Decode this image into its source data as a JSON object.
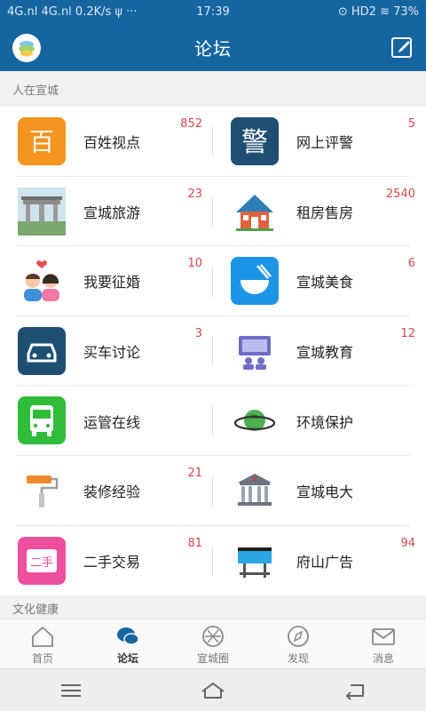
{
  "status_bar": {
    "left": "4G.nl 4G.nl 0.2K/s ψ ···",
    "time": "17:39",
    "right": "⊙ HD2 ≋ 73%"
  },
  "header": {
    "title": "论坛"
  },
  "sections": {
    "people": "人在宣城",
    "culture": "文化健康"
  },
  "grid": {
    "items": [
      {
        "label": "百姓视点",
        "badge": "852",
        "icon": "bai-icon"
      },
      {
        "label": "网上评警",
        "badge": "5",
        "icon": "jing-icon"
      },
      {
        "label": "宣城旅游",
        "badge": "23",
        "icon": "gate-icon"
      },
      {
        "label": "租房售房",
        "badge": "2540",
        "icon": "house-icon"
      },
      {
        "label": "我要征婚",
        "badge": "10",
        "icon": "couple-icon"
      },
      {
        "label": "宣城美食",
        "badge": "6",
        "icon": "bowl-icon"
      },
      {
        "label": "买车讨论",
        "badge": "3",
        "icon": "car-icon"
      },
      {
        "label": "宣城教育",
        "badge": "12",
        "icon": "classroom-icon"
      },
      {
        "label": "运管在线",
        "badge": "",
        "icon": "bus-icon"
      },
      {
        "label": "环境保护",
        "badge": "",
        "icon": "planet-icon"
      },
      {
        "label": "装修经验",
        "badge": "21",
        "icon": "paint-roller-icon"
      },
      {
        "label": "宣城电大",
        "badge": "",
        "icon": "university-icon"
      },
      {
        "label": "二手交易",
        "badge": "81",
        "icon": "secondhand-icon"
      },
      {
        "label": "府山广告",
        "badge": "94",
        "icon": "billboard-icon"
      }
    ],
    "second_hand_text": "二手"
  },
  "tabbar": {
    "tabs": [
      {
        "label": "首页",
        "icon": "home-icon"
      },
      {
        "label": "论坛",
        "icon": "chat-icon"
      },
      {
        "label": "宣城圈",
        "icon": "aperture-icon"
      },
      {
        "label": "发现",
        "icon": "compass-icon"
      },
      {
        "label": "消息",
        "icon": "mail-icon"
      }
    ],
    "active": 1
  },
  "icon_texts": {
    "bai": "百",
    "jing": "警"
  },
  "colors": {
    "primary": "#1565a0",
    "badge": "#d0494c",
    "bai_bg": "#f5941e",
    "jing_bg": "#1e4f73",
    "bowl_bg": "#1d95e6",
    "car_bg": "#1e4f73",
    "bus_bg": "#2fbd39",
    "secondhand_bg": "#ee4f9c"
  }
}
